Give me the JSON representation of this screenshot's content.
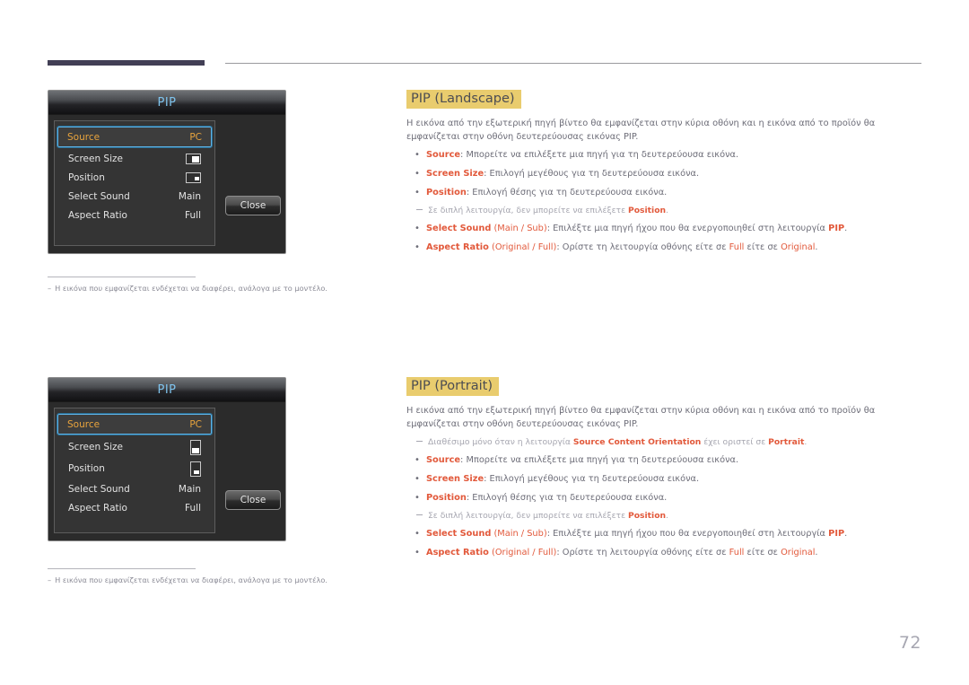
{
  "page": {
    "number": "72"
  },
  "figures": [
    {
      "id": "pip-landscape-osd",
      "title": "PIP",
      "rows": [
        {
          "label": "Source",
          "value": "PC",
          "value_type": "text",
          "selected": true
        },
        {
          "label": "Screen Size",
          "value": "",
          "value_type": "icon-screen-size",
          "selected": false
        },
        {
          "label": "Position",
          "value": "",
          "value_type": "icon-position",
          "selected": false
        },
        {
          "label": "Select Sound",
          "value": "Main",
          "value_type": "text",
          "selected": false
        },
        {
          "label": "Aspect Ratio",
          "value": "Full",
          "value_type": "text",
          "selected": false
        }
      ],
      "close_label": "Close",
      "note_dash": "–",
      "note": "Η εικόνα που εμφανίζεται ενδέχεται να διαφέρει, ανάλογα με το μοντέλο."
    },
    {
      "id": "pip-portrait-osd",
      "title": "PIP",
      "rows": [
        {
          "label": "Source",
          "value": "PC",
          "value_type": "text",
          "selected": true
        },
        {
          "label": "Screen Size",
          "value": "",
          "value_type": "icon-screen-size",
          "selected": false
        },
        {
          "label": "Position",
          "value": "",
          "value_type": "icon-position",
          "selected": false
        },
        {
          "label": "Select Sound",
          "value": "Main",
          "value_type": "text",
          "selected": false
        },
        {
          "label": "Aspect Ratio",
          "value": "Full",
          "value_type": "text",
          "selected": false
        }
      ],
      "close_label": "Close",
      "note_dash": "–",
      "note": "Η εικόνα που εμφανίζεται ενδέχεται να διαφέρει, ανάλογα με το μοντέλο."
    }
  ],
  "sections": [
    {
      "id": "pip-landscape",
      "heading": "PIP (Landscape)",
      "paragraph": "Η εικόνα από την εξωτερική πηγή βίντεο θα εμφανίζεται στην κύρια οθόνη και η εικόνα από το προϊόν θα εμφανίζεται στην οθόνη δευτερεύουσας εικόνας PIP.",
      "items": [
        {
          "type": "bullet",
          "key": "Source",
          "text": ": Μπορείτε να επιλέξετε μια πηγή για τη δευτερεύουσα εικόνα."
        },
        {
          "type": "bullet",
          "key": "Screen Size",
          "text": ": Επιλογή μεγέθους για τη δευτερεύουσα εικόνα."
        },
        {
          "type": "bullet",
          "key": "Position",
          "text": ": Επιλογή θέσης για τη δευτερεύουσα εικόνα."
        },
        {
          "type": "subnote",
          "pre": "Σε διπλή λειτουργία, δεν μπορείτε να επιλέξετε ",
          "key": "Position",
          "post": "."
        },
        {
          "type": "bullet-sound",
          "key": "Select Sound",
          "opt1": "Main",
          "sep": " / ",
          "opt2": "Sub",
          "text": ": Επιλέξτε μια πηγή ήχου που θα ενεργοποιηθεί στη λειτουργία ",
          "tail_key": "PIP",
          "tail": "."
        },
        {
          "type": "bullet-aspect",
          "key": "Aspect Ratio",
          "opt1": "Original",
          "sep": " / ",
          "opt2": "Full",
          "text": ": Ορίστε τη λειτουργία οθόνης είτε σε ",
          "mid_key": "Full",
          "mid": " είτε σε ",
          "tail_key": "Original",
          "tail": "."
        }
      ]
    },
    {
      "id": "pip-portrait",
      "heading": "PIP (Portrait)",
      "paragraph": "Η εικόνα από την εξωτερική πηγή βίντεο θα εμφανίζεται στην κύρια οθόνη και η εικόνα από το προϊόν θα εμφανίζεται στην οθόνη δευτερεύουσας εικόνας PIP.",
      "items": [
        {
          "type": "subnote-orientation",
          "pre": "Διαθέσιμο μόνο όταν η λειτουργία ",
          "key": "Source Content Orientation",
          "mid": " έχει οριστεί σε ",
          "tail_key": "Portrait",
          "post": "."
        },
        {
          "type": "bullet",
          "key": "Source",
          "text": ": Μπορείτε να επιλέξετε μια πηγή για τη δευτερεύουσα εικόνα."
        },
        {
          "type": "bullet",
          "key": "Screen Size",
          "text": ": Επιλογή μεγέθους για τη δευτερεύουσα εικόνα."
        },
        {
          "type": "bullet",
          "key": "Position",
          "text": ": Επιλογή θέσης για τη δευτερεύουσα εικόνα."
        },
        {
          "type": "subnote",
          "pre": "Σε διπλή λειτουργία, δεν μπορείτε να επιλέξετε ",
          "key": "Position",
          "post": "."
        },
        {
          "type": "bullet-sound",
          "key": "Select Sound",
          "opt1": "Main",
          "sep": " / ",
          "opt2": "Sub",
          "text": ": Επιλέξτε μια πηγή ήχου που θα ενεργοποιηθεί στη λειτουργία ",
          "tail_key": "PIP",
          "tail": "."
        },
        {
          "type": "bullet-aspect",
          "key": "Aspect Ratio",
          "opt1": "Original",
          "sep": " / ",
          "opt2": "Full",
          "text": ": Ορίστε τη λειτουργία οθόνης είτε σε ",
          "mid_key": "Full",
          "mid": " είτε σε ",
          "tail_key": "Original",
          "tail": "."
        }
      ]
    }
  ],
  "colors": {
    "heading_highlight": "#e9cc6e",
    "keyword": "#e2593b",
    "body_text": "#6d6d78",
    "subnote_text": "#a6a6b0",
    "osd_title": "#7fc4ee",
    "osd_selected": "#e8a33d",
    "rule_dark": "#423f55"
  }
}
